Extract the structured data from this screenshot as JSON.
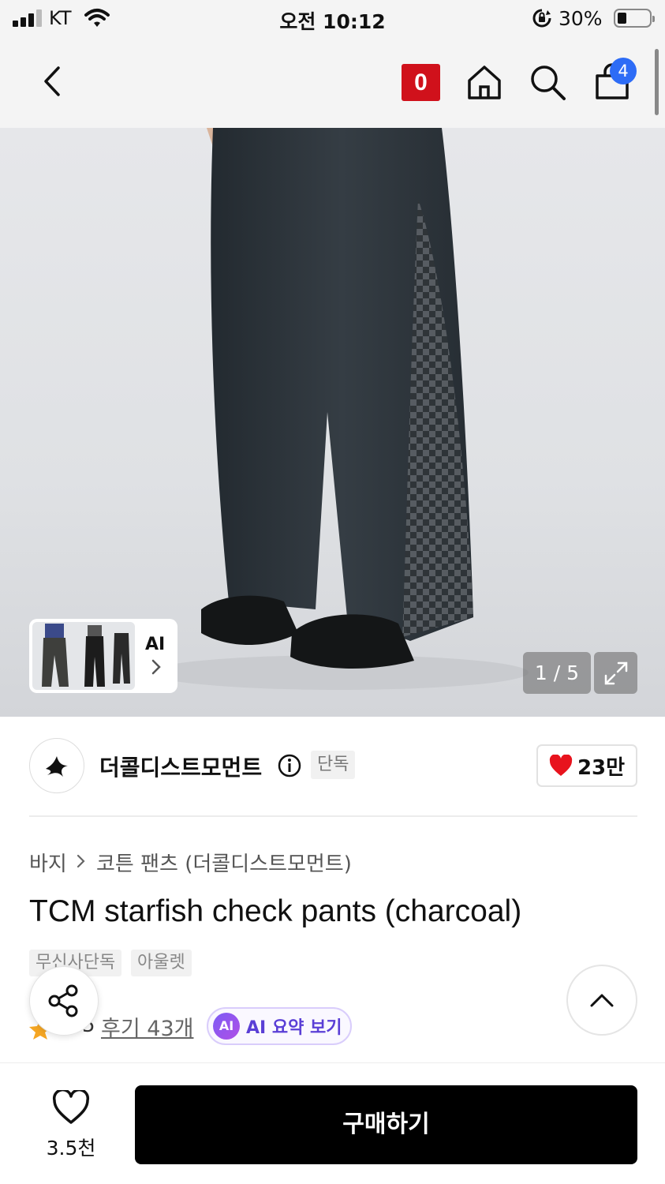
{
  "status_bar": {
    "carrier": "KT",
    "time": "오전 10:12",
    "battery_percent": "30%"
  },
  "nav": {
    "logo_letter": "0",
    "cart_count": "4",
    "icons": [
      "back-icon",
      "home-icon",
      "search-icon",
      "cart-icon"
    ]
  },
  "gallery": {
    "ai_label": "AI",
    "counter": "1 / 5",
    "current_image": 1,
    "total_images": 5
  },
  "brand": {
    "name": "더콜디스트모먼트",
    "exclusive_tag": "단독",
    "likes": "23만"
  },
  "breadcrumb": {
    "category": "바지",
    "subcategory": "코튼 팬츠 (더콜디스트모먼트)"
  },
  "product": {
    "title": "TCM starfish check pants (charcoal)",
    "tags": [
      "무신사단독",
      "아울렛"
    ]
  },
  "reviews": {
    "rating_tail": "5",
    "review_link": "후기 43개",
    "ai_chip": "AI",
    "ai_summary": "AI 요약 보기"
  },
  "bottom": {
    "wish_count": "3.5천",
    "buy_label": "구매하기"
  },
  "colors": {
    "brand_red": "#d0111b",
    "badge_blue": "#2d6cf6",
    "ai_purple": "#7b5cf5",
    "heart_red": "#e8131d",
    "star_orange": "#f5a623"
  }
}
